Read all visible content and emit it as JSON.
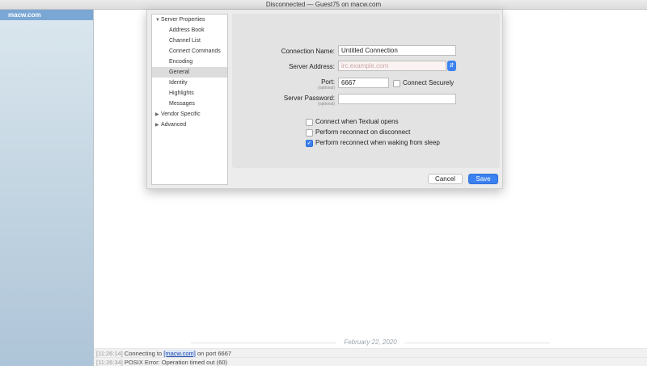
{
  "window": {
    "title": "Disconnected — Guest75 on macw.com"
  },
  "sidebar": {
    "server": "macw.com"
  },
  "nav": {
    "items": [
      {
        "label": "Server Properties",
        "kind": "group",
        "expanded": true
      },
      {
        "label": "Address Book",
        "kind": "child"
      },
      {
        "label": "Channel List",
        "kind": "child"
      },
      {
        "label": "Connect Commands",
        "kind": "child"
      },
      {
        "label": "Encoding",
        "kind": "child"
      },
      {
        "label": "General",
        "kind": "child",
        "selected": true
      },
      {
        "label": "Identity",
        "kind": "child"
      },
      {
        "label": "Highlights",
        "kind": "child"
      },
      {
        "label": "Messages",
        "kind": "child"
      },
      {
        "label": "Vendor Specific",
        "kind": "group",
        "expanded": false
      },
      {
        "label": "Advanced",
        "kind": "group",
        "expanded": false
      }
    ]
  },
  "form": {
    "connection_name": {
      "label": "Connection Name:",
      "value": "Untitled Connection"
    },
    "server_address": {
      "label": "Server Address:",
      "placeholder": "irc.example.com",
      "value": ""
    },
    "port": {
      "label": "Port:",
      "sublabel": "(optional)",
      "value": "6667"
    },
    "connect_securely": {
      "label": "Connect Securely",
      "checked": false
    },
    "server_password": {
      "label": "Server Password:",
      "sublabel": "(optional)",
      "value": ""
    },
    "options": [
      {
        "label": "Connect when Textual opens",
        "checked": false
      },
      {
        "label": "Perform reconnect on disconnect",
        "checked": false
      },
      {
        "label": "Perform reconnect when waking from sleep",
        "checked": true
      }
    ]
  },
  "buttons": {
    "cancel": "Cancel",
    "save": "Save"
  },
  "log": {
    "date": "February 22, 2020",
    "lines": [
      {
        "time": "[11:26:14]",
        "pre": " Connecting to ",
        "link": "[macw.com]",
        "post": " on port 6667"
      },
      {
        "time": "[11:26:34]",
        "pre": " POSIX Error: Operation timed out (60)",
        "link": "",
        "post": ""
      }
    ]
  },
  "colors": {
    "accent": "#3b82f0",
    "sidebar_selected": "#7aa7d4"
  },
  "icons": {
    "popup": "chevron-updown-icon",
    "check": "checkmark-icon",
    "expanded": "triangle-down-icon",
    "collapsed": "triangle-right-icon"
  }
}
